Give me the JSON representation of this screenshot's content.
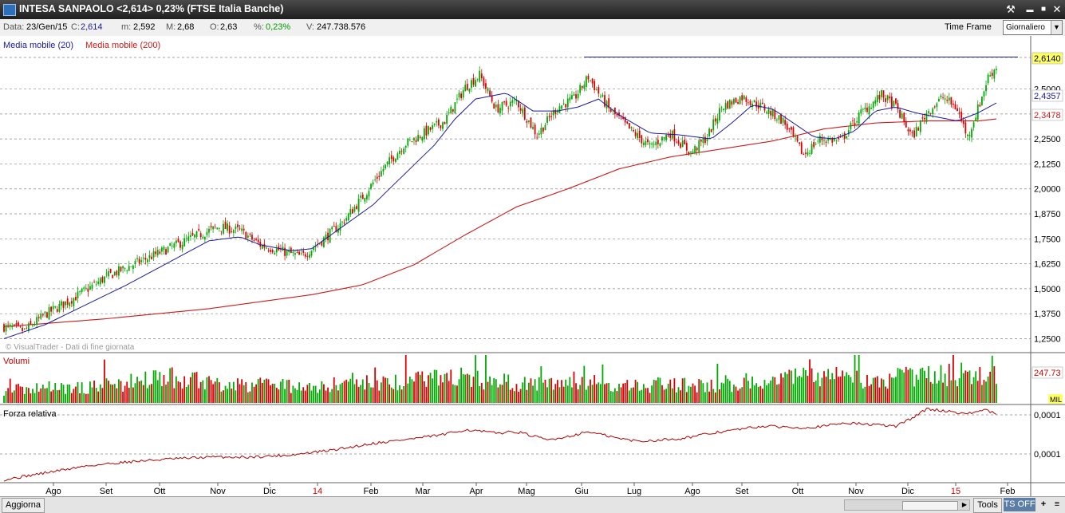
{
  "window": {
    "title": "INTESA SANPAOLO <2,614> 0,23%  (FTSE Italia Banche)",
    "buttons": {
      "tools": "⚒",
      "minimize": "▬",
      "maximize": "■",
      "close": "✕"
    }
  },
  "infobar": {
    "data_label": "Data:",
    "data_value": "23/Gen/15",
    "close_label": "C:",
    "close_value": "2,614",
    "min_label": "m:",
    "min_value": "2,592",
    "max_label": "M:",
    "max_value": "2,68",
    "open_label": "O:",
    "open_value": "2,63",
    "pct_label": "%:",
    "pct_value": "0,23%",
    "vol_label": "V:",
    "vol_value": "247.738.576",
    "timeframe_label": "Time Frame",
    "timeframe_value": "Giornaliero"
  },
  "statusbar": {
    "refresh": "Aggiorna",
    "tools": "Tools",
    "ts": "TS OFF",
    "plus": "+",
    "menu": "≡"
  },
  "colors": {
    "up": "#00aa00",
    "down": "#dd0000",
    "ma20": "#1a1aa0",
    "ma200": "#cc1a1a",
    "rs": "#b00000",
    "grid": "#8a8a8a",
    "price_tag": "#ffff66"
  },
  "chart_data": [
    {
      "type": "candlestick",
      "title": "INTESA SANPAOLO",
      "legend": [
        "Media mobile (20)",
        "Media mobile (200)"
      ],
      "watermark": "© VisualTrader - Dati di fine giornata",
      "y_ticks": [
        "2,5000",
        "2,3750",
        "2,2500",
        "2,1250",
        "2,0000",
        "1,8750",
        "1,7500",
        "1,6250",
        "1,5000",
        "1,3750",
        "1,2500"
      ],
      "ylim": [
        1.2,
        2.75
      ],
      "x_labels": [
        "Ago",
        "Set",
        "Ott",
        "Nov",
        "Dic",
        "14",
        "Feb",
        "Mar",
        "Apr",
        "Mag",
        "Giu",
        "Lug",
        "Ago",
        "Set",
        "Ott",
        "Nov",
        "Dic",
        "15",
        "Feb"
      ],
      "price_tags": {
        "last": "2,6140",
        "ma20": "2,4357",
        "ma200": "2,3478"
      },
      "close_anchors": [
        [
          0,
          1.31
        ],
        [
          10,
          1.29
        ],
        [
          20,
          1.37
        ],
        [
          35,
          1.46
        ],
        [
          50,
          1.56
        ],
        [
          65,
          1.63
        ],
        [
          80,
          1.7
        ],
        [
          95,
          1.77
        ],
        [
          105,
          1.81
        ],
        [
          115,
          1.79
        ],
        [
          125,
          1.72
        ],
        [
          135,
          1.69
        ],
        [
          145,
          1.66
        ],
        [
          155,
          1.74
        ],
        [
          165,
          1.83
        ],
        [
          175,
          1.96
        ],
        [
          185,
          2.1
        ],
        [
          195,
          2.22
        ],
        [
          205,
          2.28
        ],
        [
          215,
          2.34
        ],
        [
          225,
          2.51
        ],
        [
          232,
          2.57
        ],
        [
          240,
          2.4
        ],
        [
          250,
          2.44
        ],
        [
          260,
          2.27
        ],
        [
          270,
          2.41
        ],
        [
          278,
          2.45
        ],
        [
          285,
          2.56
        ],
        [
          295,
          2.4
        ],
        [
          305,
          2.3
        ],
        [
          315,
          2.21
        ],
        [
          325,
          2.28
        ],
        [
          335,
          2.18
        ],
        [
          343,
          2.26
        ],
        [
          350,
          2.41
        ],
        [
          360,
          2.46
        ],
        [
          370,
          2.41
        ],
        [
          380,
          2.34
        ],
        [
          390,
          2.17
        ],
        [
          398,
          2.25
        ],
        [
          408,
          2.24
        ],
        [
          418,
          2.38
        ],
        [
          428,
          2.47
        ],
        [
          435,
          2.41
        ],
        [
          443,
          2.26
        ],
        [
          450,
          2.38
        ],
        [
          458,
          2.46
        ],
        [
          465,
          2.4
        ],
        [
          470,
          2.26
        ],
        [
          476,
          2.43
        ],
        [
          480,
          2.56
        ],
        [
          484,
          2.61
        ]
      ],
      "ma20_anchors": [
        [
          0,
          1.25
        ],
        [
          20,
          1.32
        ],
        [
          40,
          1.42
        ],
        [
          60,
          1.52
        ],
        [
          80,
          1.63
        ],
        [
          100,
          1.74
        ],
        [
          115,
          1.76
        ],
        [
          125,
          1.72
        ],
        [
          140,
          1.69
        ],
        [
          150,
          1.7
        ],
        [
          165,
          1.81
        ],
        [
          180,
          1.92
        ],
        [
          195,
          2.07
        ],
        [
          210,
          2.22
        ],
        [
          220,
          2.35
        ],
        [
          230,
          2.45
        ],
        [
          245,
          2.48
        ],
        [
          258,
          2.39
        ],
        [
          270,
          2.39
        ],
        [
          280,
          2.41
        ],
        [
          290,
          2.45
        ],
        [
          300,
          2.37
        ],
        [
          315,
          2.28
        ],
        [
          330,
          2.27
        ],
        [
          345,
          2.25
        ],
        [
          355,
          2.33
        ],
        [
          365,
          2.42
        ],
        [
          375,
          2.4
        ],
        [
          385,
          2.33
        ],
        [
          395,
          2.26
        ],
        [
          405,
          2.25
        ],
        [
          415,
          2.29
        ],
        [
          425,
          2.39
        ],
        [
          435,
          2.41
        ],
        [
          445,
          2.38
        ],
        [
          455,
          2.36
        ],
        [
          465,
          2.34
        ],
        [
          475,
          2.38
        ],
        [
          484,
          2.43
        ]
      ],
      "ma200_anchors": [
        [
          0,
          1.31
        ],
        [
          50,
          1.35
        ],
        [
          100,
          1.4
        ],
        [
          150,
          1.47
        ],
        [
          175,
          1.52
        ],
        [
          200,
          1.62
        ],
        [
          225,
          1.77
        ],
        [
          250,
          1.91
        ],
        [
          275,
          2.0
        ],
        [
          300,
          2.1
        ],
        [
          325,
          2.16
        ],
        [
          350,
          2.2
        ],
        [
          375,
          2.24
        ],
        [
          400,
          2.3
        ],
        [
          425,
          2.33
        ],
        [
          450,
          2.34
        ],
        [
          475,
          2.34
        ],
        [
          484,
          2.35
        ]
      ],
      "resistance_level": 2.66
    },
    {
      "type": "bar",
      "title": "Volumi",
      "tags": {
        "last": "247.73",
        "unit": "MIL"
      },
      "volume_profile": [
        [
          0,
          0.3
        ],
        [
          30,
          0.33
        ],
        [
          60,
          0.45
        ],
        [
          80,
          0.62
        ],
        [
          100,
          0.45
        ],
        [
          130,
          0.4
        ],
        [
          160,
          0.42
        ],
        [
          200,
          0.5
        ],
        [
          225,
          0.6
        ],
        [
          250,
          0.45
        ],
        [
          280,
          0.52
        ],
        [
          300,
          0.42
        ],
        [
          340,
          0.4
        ],
        [
          360,
          0.48
        ],
        [
          400,
          0.6
        ],
        [
          420,
          0.55
        ],
        [
          450,
          0.6
        ],
        [
          484,
          0.7
        ]
      ]
    },
    {
      "type": "line",
      "title": "Forza relativa",
      "y_ticks": [
        "0,0001",
        "0,0001"
      ],
      "rs_anchors": [
        [
          0,
          0.02
        ],
        [
          20,
          0.12
        ],
        [
          40,
          0.22
        ],
        [
          60,
          0.28
        ],
        [
          80,
          0.32
        ],
        [
          100,
          0.35
        ],
        [
          120,
          0.35
        ],
        [
          140,
          0.38
        ],
        [
          160,
          0.45
        ],
        [
          180,
          0.55
        ],
        [
          200,
          0.62
        ],
        [
          215,
          0.68
        ],
        [
          225,
          0.75
        ],
        [
          240,
          0.7
        ],
        [
          250,
          0.72
        ],
        [
          265,
          0.6
        ],
        [
          275,
          0.65
        ],
        [
          285,
          0.72
        ],
        [
          300,
          0.62
        ],
        [
          310,
          0.58
        ],
        [
          330,
          0.62
        ],
        [
          350,
          0.72
        ],
        [
          370,
          0.8
        ],
        [
          390,
          0.78
        ],
        [
          400,
          0.8
        ],
        [
          410,
          0.85
        ],
        [
          425,
          0.82
        ],
        [
          435,
          0.8
        ],
        [
          443,
          0.92
        ],
        [
          450,
          1.05
        ],
        [
          460,
          1.02
        ],
        [
          470,
          0.98
        ],
        [
          478,
          1.04
        ],
        [
          484,
          0.98
        ]
      ]
    }
  ]
}
